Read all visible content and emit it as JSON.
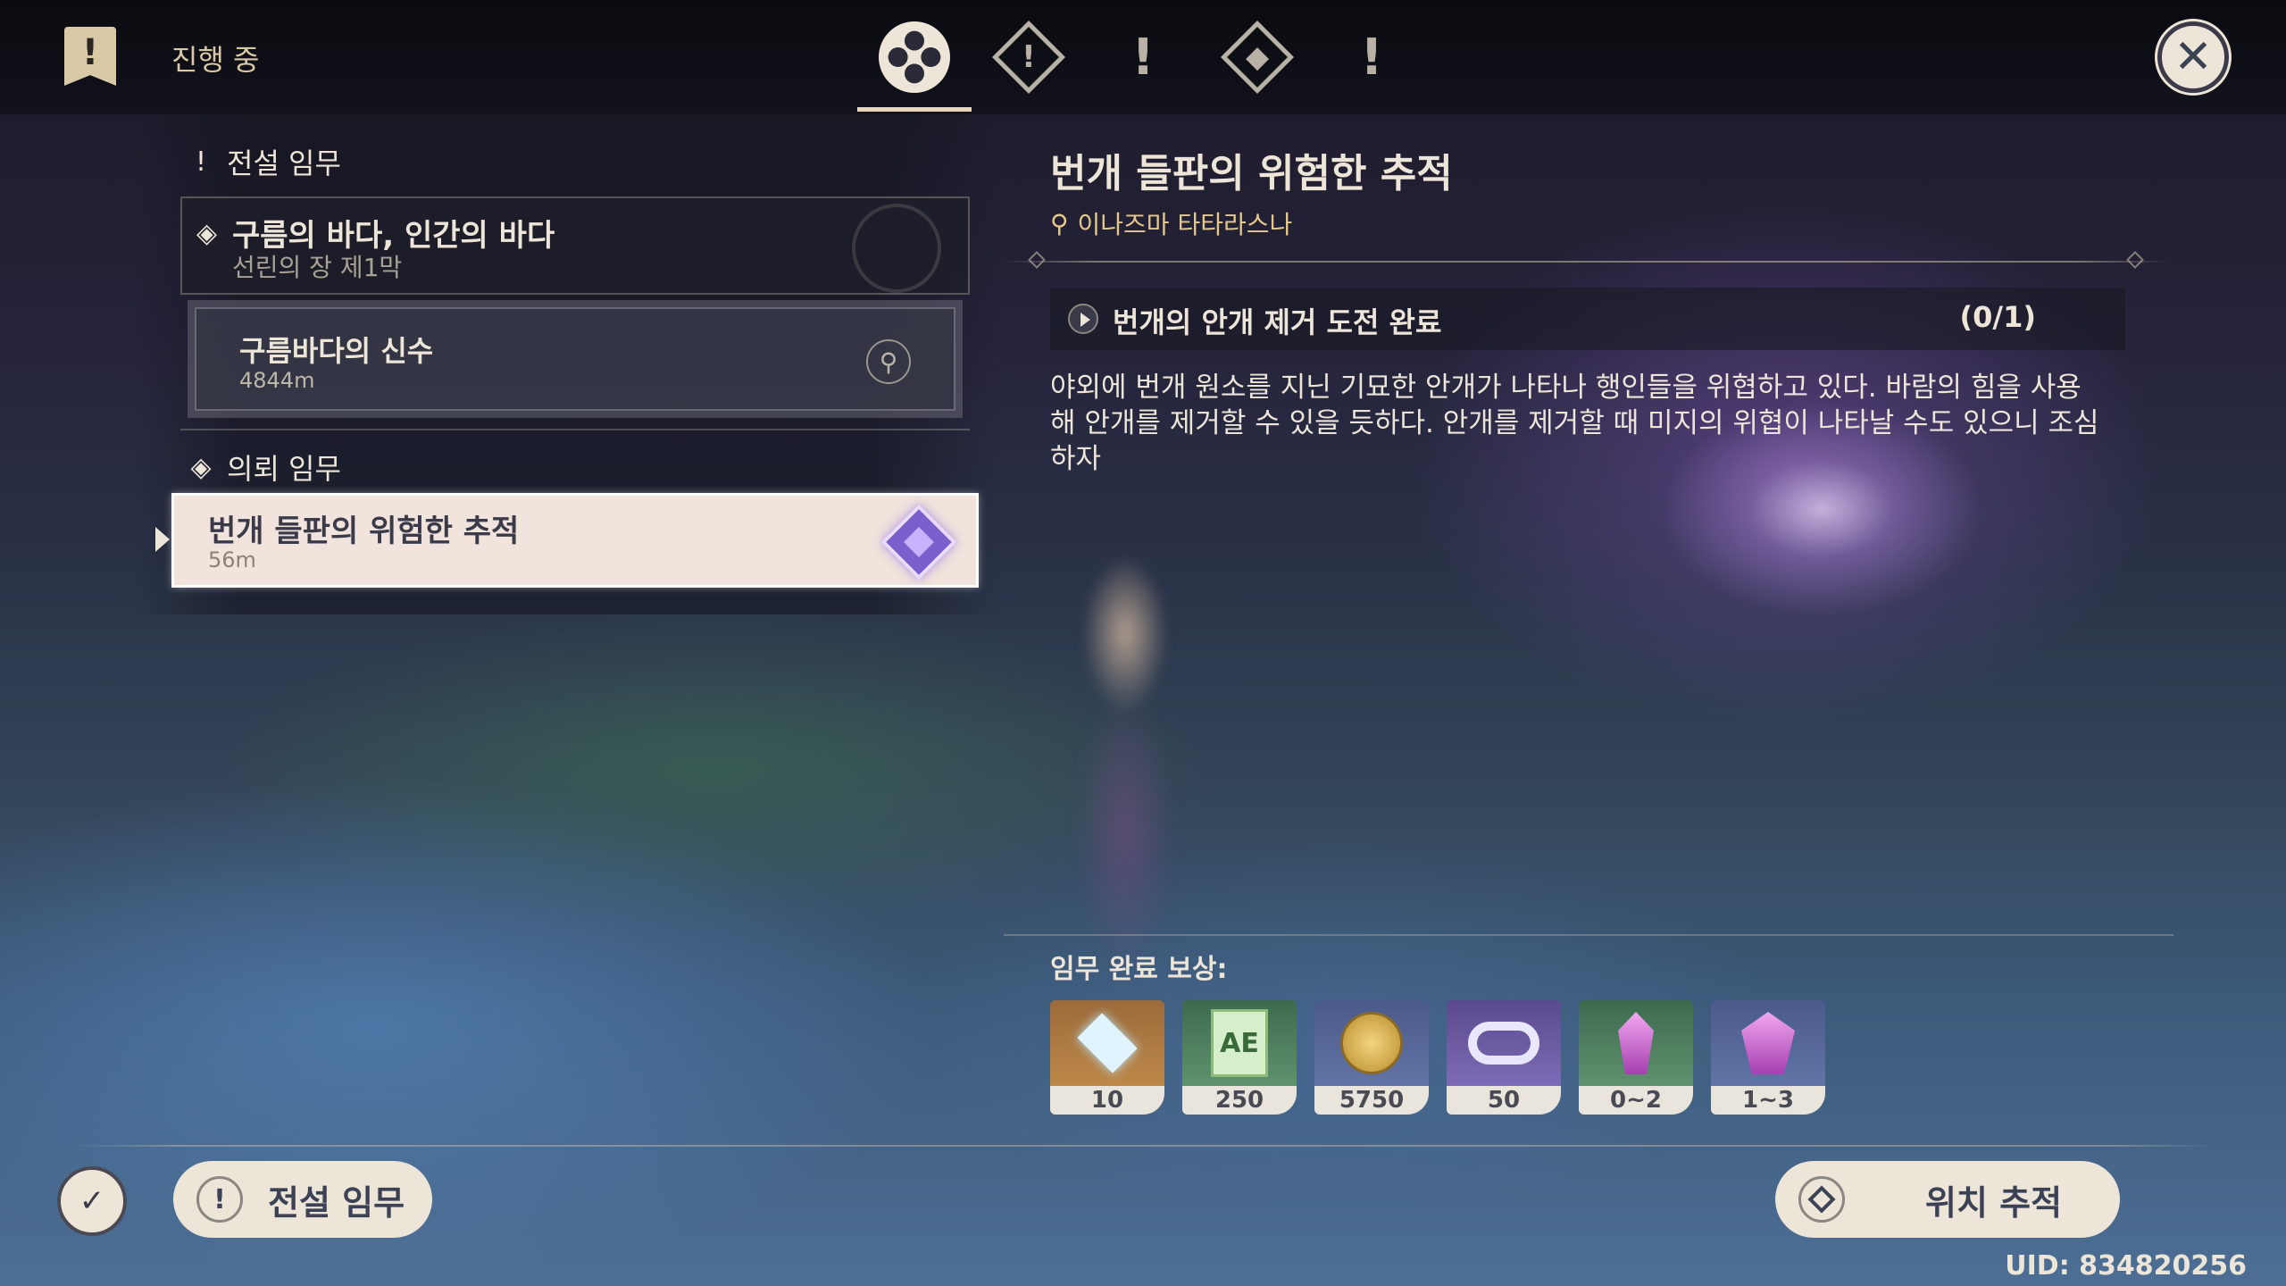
{
  "header": {
    "status_label": "진행 중",
    "tabs": [
      {
        "name": "all",
        "active": true
      },
      {
        "name": "archon",
        "active": false
      },
      {
        "name": "story",
        "active": false
      },
      {
        "name": "commission",
        "active": false
      },
      {
        "name": "world",
        "active": false
      }
    ]
  },
  "left_panel": {
    "archon_section_title": "전설 임무",
    "archon_quest": {
      "title": "구름의 바다, 인간의 바다",
      "subtitle": "선린의 장 제1막"
    },
    "archon_subquest": {
      "title": "구름바다의 신수",
      "distance": "4844m"
    },
    "commission_section_title": "의뢰 임무",
    "commission_quest": {
      "title": "번개 들판의 위험한 추적",
      "distance": "56m"
    }
  },
  "detail": {
    "title": "번개 들판의 위험한 추적",
    "location": "이나즈마 타타라스나",
    "objective": {
      "text": "번개의 안개 제거 도전 완료",
      "progress": "(0/1)"
    },
    "description": "야외에 번개 원소를 지닌 기묘한 안개가 나타나 행인들을 위협하고 있다. 바람의 힘을 사용해 안개를 제거할 수 있을 듯하다. 안개를 제거할 때 미지의 위협이 나타날 수도 있으니 조심하자",
    "rewards_label": "임무 완료 보상:",
    "rewards": [
      {
        "item": "primogem",
        "qty": "10",
        "rarity_color": "#c8934e"
      },
      {
        "item": "adventure-exp",
        "qty": "250",
        "rarity_color": "#6aa07a"
      },
      {
        "item": "mora",
        "qty": "5750",
        "rarity_color": "#6a7cb0"
      },
      {
        "item": "companionship-exp",
        "qty": "50",
        "rarity_color": "#8a76c4"
      },
      {
        "item": "crystal-small",
        "qty": "0~2",
        "rarity_color": "#6aa07a"
      },
      {
        "item": "crystal-large",
        "qty": "1~3",
        "rarity_color": "#6a7cb0"
      }
    ]
  },
  "footer": {
    "filter_label": "전설 임무",
    "track_label": "위치 추적",
    "uid": "UID: 834820256"
  }
}
